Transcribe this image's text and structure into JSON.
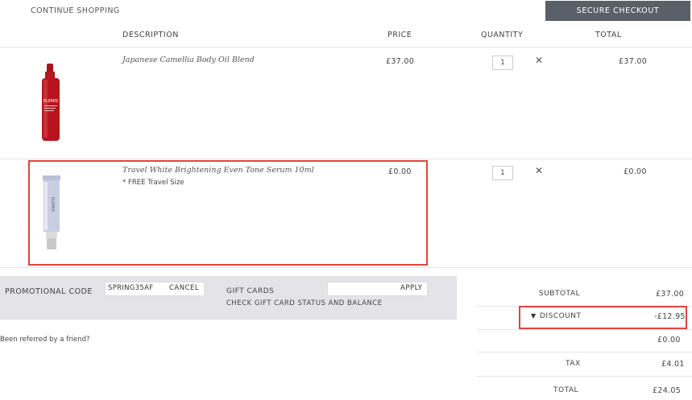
{
  "header": {
    "continue_label": "CONTINUE SHOPPING",
    "checkout_label": "SECURE CHECKOUT"
  },
  "columns": {
    "description": "DESCRIPTION",
    "price": "PRICE",
    "quantity": "QUANTITY",
    "total": "TOTAL"
  },
  "items": [
    {
      "name": "Japanese Camellia Body Oil Blend",
      "note": "",
      "price": "£37.00",
      "quantity": "1",
      "total": "£37.00",
      "remove_icon": "close-icon",
      "image_brand": "ELEMIS"
    },
    {
      "name": "Travel White Brightening Even Tone Serum 10ml",
      "note": "* FREE Travel Size",
      "price": "£0.00",
      "quantity": "1",
      "total": "£0.00",
      "remove_icon": "close-icon",
      "image_brand": "ELEMIS"
    }
  ],
  "promo": {
    "label": "PROMOTIONAL CODE",
    "code": "SPRING35AF",
    "cancel_label": "CANCEL",
    "gift_cards_label": "GIFT CARDS",
    "gift_card_value": "",
    "apply_label": "APPLY",
    "check_balance_label": "CHECK GIFT CARD STATUS AND BALANCE",
    "band_color": "#e3e3e8"
  },
  "referral_text": "Been referred by a friend?",
  "summary": {
    "subtotal_label": "SUBTOTAL",
    "subtotal_value": "£37.00",
    "discount_label": "DISCOUNT",
    "discount_value": "-£12.95",
    "discount_icon": "triangle-down-icon",
    "extra_value": "£0.00",
    "tax_label": "TAX",
    "tax_value": "£4.01",
    "total_label": "TOTAL",
    "total_value": "£24.05"
  },
  "colors": {
    "accent": "#5a6067",
    "highlight": "#e0443e"
  }
}
